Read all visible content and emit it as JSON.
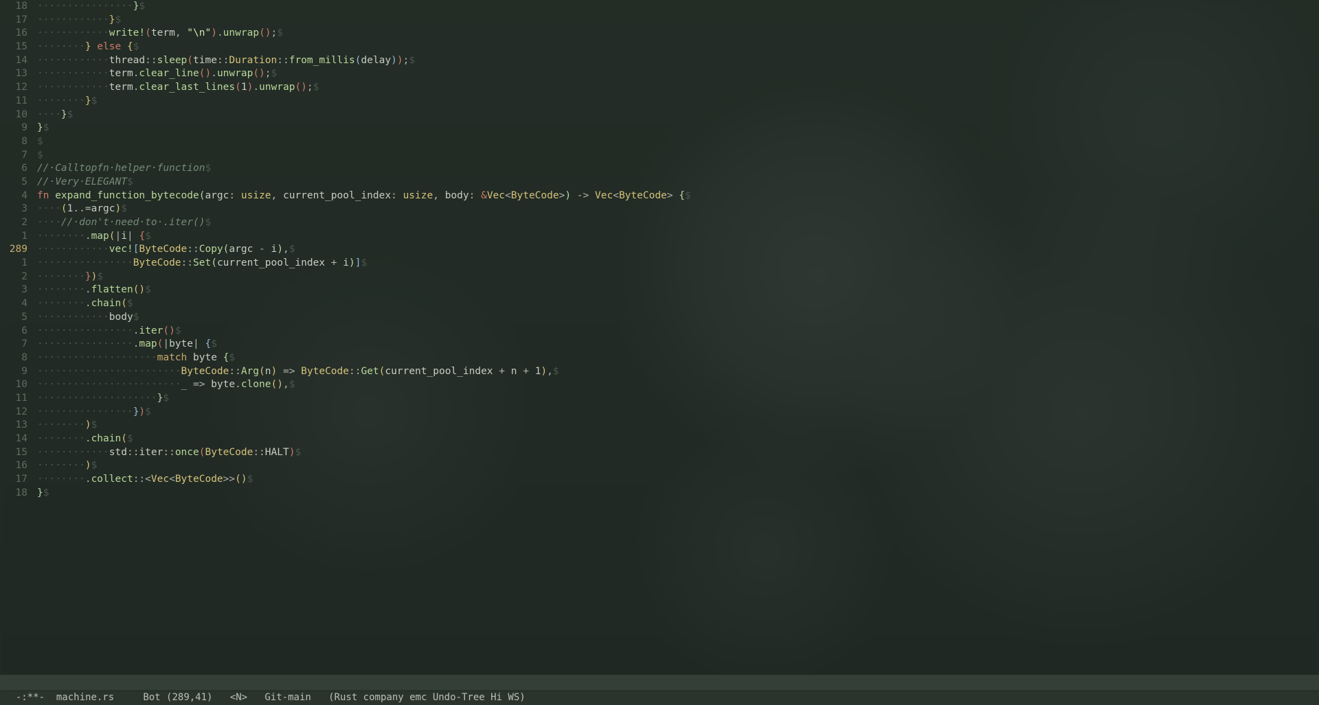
{
  "modeline": {
    "left": "-:**-",
    "buffer": "machine.rs",
    "position": "Bot (289,41)",
    "state": "<N>",
    "vc": "Git-main",
    "modes": "(Rust company emc Undo-Tree Hi WS)"
  },
  "cursor_line_index": 18,
  "lines": [
    {
      "num": "18",
      "tokens": [
        {
          "c": "ws",
          "t": "················"
        },
        {
          "c": "par1",
          "t": "}"
        },
        {
          "c": "eol",
          "t": "$"
        }
      ]
    },
    {
      "num": "17",
      "tokens": [
        {
          "c": "ws",
          "t": "············"
        },
        {
          "c": "par2",
          "t": "}"
        },
        {
          "c": "eol",
          "t": "$"
        }
      ]
    },
    {
      "num": "16",
      "tokens": [
        {
          "c": "ws",
          "t": "············"
        },
        {
          "c": "mac",
          "t": "write!"
        },
        {
          "c": "par3",
          "t": "("
        },
        {
          "c": "id",
          "t": "term"
        },
        {
          "c": "p",
          "t": ", "
        },
        {
          "c": "str",
          "t": "\"\\n\""
        },
        {
          "c": "par3",
          "t": ")"
        },
        {
          "c": "p",
          "t": "."
        },
        {
          "c": "fn",
          "t": "unwrap"
        },
        {
          "c": "par3",
          "t": "()"
        },
        {
          "c": "p",
          "t": ";"
        },
        {
          "c": "eol",
          "t": "$"
        }
      ]
    },
    {
      "num": "15",
      "tokens": [
        {
          "c": "ws",
          "t": "········"
        },
        {
          "c": "par2",
          "t": "}"
        },
        {
          "c": "p",
          "t": " "
        },
        {
          "c": "kw",
          "t": "else"
        },
        {
          "c": "p",
          "t": " "
        },
        {
          "c": "par2",
          "t": "{"
        },
        {
          "c": "eol",
          "t": "$"
        }
      ]
    },
    {
      "num": "14",
      "tokens": [
        {
          "c": "ws",
          "t": "············"
        },
        {
          "c": "id",
          "t": "thread"
        },
        {
          "c": "p",
          "t": "::"
        },
        {
          "c": "fn",
          "t": "sleep"
        },
        {
          "c": "par3",
          "t": "("
        },
        {
          "c": "id",
          "t": "time"
        },
        {
          "c": "p",
          "t": "::"
        },
        {
          "c": "ty",
          "t": "Duration"
        },
        {
          "c": "p",
          "t": "::"
        },
        {
          "c": "fn",
          "t": "from_millis"
        },
        {
          "c": "par4",
          "t": "("
        },
        {
          "c": "id",
          "t": "delay"
        },
        {
          "c": "par4",
          "t": ")"
        },
        {
          "c": "par3",
          "t": ")"
        },
        {
          "c": "p",
          "t": ";"
        },
        {
          "c": "eol",
          "t": "$"
        }
      ]
    },
    {
      "num": "13",
      "tokens": [
        {
          "c": "ws",
          "t": "············"
        },
        {
          "c": "id",
          "t": "term"
        },
        {
          "c": "p",
          "t": "."
        },
        {
          "c": "fn",
          "t": "clear_line"
        },
        {
          "c": "par3",
          "t": "()"
        },
        {
          "c": "p",
          "t": "."
        },
        {
          "c": "fn",
          "t": "unwrap"
        },
        {
          "c": "par3",
          "t": "()"
        },
        {
          "c": "p",
          "t": ";"
        },
        {
          "c": "eol",
          "t": "$"
        }
      ]
    },
    {
      "num": "12",
      "tokens": [
        {
          "c": "ws",
          "t": "············"
        },
        {
          "c": "id",
          "t": "term"
        },
        {
          "c": "p",
          "t": "."
        },
        {
          "c": "fn",
          "t": "clear_last_lines"
        },
        {
          "c": "par3",
          "t": "("
        },
        {
          "c": "num",
          "t": "1"
        },
        {
          "c": "par3",
          "t": ")"
        },
        {
          "c": "p",
          "t": "."
        },
        {
          "c": "fn",
          "t": "unwrap"
        },
        {
          "c": "par3",
          "t": "()"
        },
        {
          "c": "p",
          "t": ";"
        },
        {
          "c": "eol",
          "t": "$"
        }
      ]
    },
    {
      "num": "11",
      "tokens": [
        {
          "c": "ws",
          "t": "········"
        },
        {
          "c": "par2",
          "t": "}"
        },
        {
          "c": "eol",
          "t": "$"
        }
      ]
    },
    {
      "num": "10",
      "tokens": [
        {
          "c": "ws",
          "t": "····"
        },
        {
          "c": "par1",
          "t": "}"
        },
        {
          "c": "eol",
          "t": "$"
        }
      ]
    },
    {
      "num": "9",
      "tokens": [
        {
          "c": "par1",
          "t": "}"
        },
        {
          "c": "eol",
          "t": "$"
        }
      ]
    },
    {
      "num": "8",
      "tokens": [
        {
          "c": "eol",
          "t": "$"
        }
      ]
    },
    {
      "num": "7",
      "tokens": [
        {
          "c": "eol",
          "t": "$"
        }
      ]
    },
    {
      "num": "6",
      "tokens": [
        {
          "c": "cmt",
          "t": "// Calltopfn helper function"
        },
        {
          "c": "eol",
          "t": "$"
        }
      ]
    },
    {
      "num": "5",
      "tokens": [
        {
          "c": "cmt",
          "t": "// Very ELEGANT"
        },
        {
          "c": "eol",
          "t": "$"
        }
      ]
    },
    {
      "num": "4",
      "tokens": [
        {
          "c": "kw",
          "t": "fn"
        },
        {
          "c": "p",
          "t": " "
        },
        {
          "c": "fn",
          "t": "expand_function_bytecode"
        },
        {
          "c": "par1",
          "t": "("
        },
        {
          "c": "id",
          "t": "argc"
        },
        {
          "c": "p",
          "t": ": "
        },
        {
          "c": "ty",
          "t": "usize"
        },
        {
          "c": "p",
          "t": ", "
        },
        {
          "c": "id",
          "t": "current_pool_index"
        },
        {
          "c": "p",
          "t": ": "
        },
        {
          "c": "ty",
          "t": "usize"
        },
        {
          "c": "p",
          "t": ", "
        },
        {
          "c": "id",
          "t": "body"
        },
        {
          "c": "p",
          "t": ": "
        },
        {
          "c": "kw",
          "t": "&"
        },
        {
          "c": "ty",
          "t": "Vec"
        },
        {
          "c": "p",
          "t": "<"
        },
        {
          "c": "ty",
          "t": "ByteCode"
        },
        {
          "c": "p",
          "t": ">"
        },
        {
          "c": "par1",
          "t": ")"
        },
        {
          "c": "p",
          "t": " -> "
        },
        {
          "c": "ty",
          "t": "Vec"
        },
        {
          "c": "p",
          "t": "<"
        },
        {
          "c": "ty",
          "t": "ByteCode"
        },
        {
          "c": "p",
          "t": "> "
        },
        {
          "c": "par1",
          "t": "{"
        },
        {
          "c": "eol",
          "t": "$"
        }
      ]
    },
    {
      "num": "3",
      "tokens": [
        {
          "c": "ws",
          "t": "····"
        },
        {
          "c": "par2",
          "t": "("
        },
        {
          "c": "num",
          "t": "1"
        },
        {
          "c": "p",
          "t": "..="
        },
        {
          "c": "id",
          "t": "argc"
        },
        {
          "c": "par2",
          "t": ")"
        },
        {
          "c": "eol",
          "t": "$"
        }
      ]
    },
    {
      "num": "2",
      "tokens": [
        {
          "c": "ws",
          "t": "····"
        },
        {
          "c": "cmt",
          "t": "// don't need to .iter()"
        },
        {
          "c": "eol",
          "t": "$"
        }
      ]
    },
    {
      "num": "1",
      "tokens": [
        {
          "c": "ws",
          "t": "········"
        },
        {
          "c": "p",
          "t": "."
        },
        {
          "c": "fn",
          "t": "map"
        },
        {
          "c": "par2",
          "t": "("
        },
        {
          "c": "p",
          "t": "|"
        },
        {
          "c": "id",
          "t": "i"
        },
        {
          "c": "p",
          "t": "| "
        },
        {
          "c": "par3",
          "t": "{"
        },
        {
          "c": "eol",
          "t": "$"
        }
      ]
    },
    {
      "num": "289",
      "cur": true,
      "tokens": [
        {
          "c": "ws",
          "t": "············"
        },
        {
          "c": "mac",
          "t": "vec!"
        },
        {
          "c": "par4",
          "t": "["
        },
        {
          "c": "ty",
          "t": "ByteCode"
        },
        {
          "c": "p",
          "t": "::"
        },
        {
          "c": "fn",
          "t": "Copy"
        },
        {
          "c": "par1",
          "t": "("
        },
        {
          "c": "id",
          "t": "argc"
        },
        {
          "c": "p",
          "t": " - "
        },
        {
          "c": "id",
          "t": "i"
        },
        {
          "c": "par1",
          "t": ")"
        },
        {
          "c": "p",
          "t": ","
        },
        {
          "c": "eol",
          "t": "$"
        }
      ]
    },
    {
      "num": "1",
      "tokens": [
        {
          "c": "ws",
          "t": "················"
        },
        {
          "c": "ty",
          "t": "ByteCode"
        },
        {
          "c": "p",
          "t": "::"
        },
        {
          "c": "fn",
          "t": "Set"
        },
        {
          "c": "par1",
          "t": "("
        },
        {
          "c": "id",
          "t": "current_pool_index"
        },
        {
          "c": "p",
          "t": " + "
        },
        {
          "c": "id",
          "t": "i"
        },
        {
          "c": "par1",
          "t": ")"
        },
        {
          "c": "par4",
          "t": "]"
        },
        {
          "c": "eol",
          "t": "$"
        }
      ]
    },
    {
      "num": "2",
      "tokens": [
        {
          "c": "ws",
          "t": "········"
        },
        {
          "c": "par3",
          "t": "}"
        },
        {
          "c": "par2",
          "t": ")"
        },
        {
          "c": "eol",
          "t": "$"
        }
      ]
    },
    {
      "num": "3",
      "tokens": [
        {
          "c": "ws",
          "t": "········"
        },
        {
          "c": "p",
          "t": "."
        },
        {
          "c": "fn",
          "t": "flatten"
        },
        {
          "c": "par2",
          "t": "()"
        },
        {
          "c": "eol",
          "t": "$"
        }
      ]
    },
    {
      "num": "4",
      "tokens": [
        {
          "c": "ws",
          "t": "········"
        },
        {
          "c": "p",
          "t": "."
        },
        {
          "c": "fn",
          "t": "chain"
        },
        {
          "c": "par2",
          "t": "("
        },
        {
          "c": "eol",
          "t": "$"
        }
      ]
    },
    {
      "num": "5",
      "tokens": [
        {
          "c": "ws",
          "t": "············"
        },
        {
          "c": "id",
          "t": "body"
        },
        {
          "c": "eol",
          "t": "$"
        }
      ]
    },
    {
      "num": "6",
      "tokens": [
        {
          "c": "ws",
          "t": "················"
        },
        {
          "c": "p",
          "t": "."
        },
        {
          "c": "fn",
          "t": "iter"
        },
        {
          "c": "par3",
          "t": "()"
        },
        {
          "c": "eol",
          "t": "$"
        }
      ]
    },
    {
      "num": "7",
      "tokens": [
        {
          "c": "ws",
          "t": "················"
        },
        {
          "c": "p",
          "t": "."
        },
        {
          "c": "fn",
          "t": "map"
        },
        {
          "c": "par3",
          "t": "("
        },
        {
          "c": "p",
          "t": "|"
        },
        {
          "c": "id",
          "t": "byte"
        },
        {
          "c": "p",
          "t": "| "
        },
        {
          "c": "par4",
          "t": "{"
        },
        {
          "c": "eol",
          "t": "$"
        }
      ]
    },
    {
      "num": "8",
      "tokens": [
        {
          "c": "ws",
          "t": "····················"
        },
        {
          "c": "kw2",
          "t": "match"
        },
        {
          "c": "p",
          "t": " "
        },
        {
          "c": "id",
          "t": "byte"
        },
        {
          "c": "p",
          "t": " "
        },
        {
          "c": "par1",
          "t": "{"
        },
        {
          "c": "eol",
          "t": "$"
        }
      ]
    },
    {
      "num": "9",
      "tokens": [
        {
          "c": "ws",
          "t": "························"
        },
        {
          "c": "ty",
          "t": "ByteCode"
        },
        {
          "c": "p",
          "t": "::"
        },
        {
          "c": "fn",
          "t": "Arg"
        },
        {
          "c": "par2",
          "t": "("
        },
        {
          "c": "id",
          "t": "n"
        },
        {
          "c": "par2",
          "t": ")"
        },
        {
          "c": "p",
          "t": " => "
        },
        {
          "c": "ty",
          "t": "ByteCode"
        },
        {
          "c": "p",
          "t": "::"
        },
        {
          "c": "fn",
          "t": "Get"
        },
        {
          "c": "par2",
          "t": "("
        },
        {
          "c": "id",
          "t": "current_pool_index"
        },
        {
          "c": "p",
          "t": " + "
        },
        {
          "c": "id",
          "t": "n"
        },
        {
          "c": "p",
          "t": " + "
        },
        {
          "c": "num",
          "t": "1"
        },
        {
          "c": "par2",
          "t": ")"
        },
        {
          "c": "p",
          "t": ","
        },
        {
          "c": "eol",
          "t": "$"
        }
      ]
    },
    {
      "num": "10",
      "tokens": [
        {
          "c": "ws",
          "t": "························"
        },
        {
          "c": "p",
          "t": "_ => "
        },
        {
          "c": "id",
          "t": "byte"
        },
        {
          "c": "p",
          "t": "."
        },
        {
          "c": "fn",
          "t": "clone"
        },
        {
          "c": "par2",
          "t": "()"
        },
        {
          "c": "p",
          "t": ","
        },
        {
          "c": "eol",
          "t": "$"
        }
      ]
    },
    {
      "num": "11",
      "tokens": [
        {
          "c": "ws",
          "t": "····················"
        },
        {
          "c": "par1",
          "t": "}"
        },
        {
          "c": "eol",
          "t": "$"
        }
      ]
    },
    {
      "num": "12",
      "tokens": [
        {
          "c": "ws",
          "t": "················"
        },
        {
          "c": "par4",
          "t": "}"
        },
        {
          "c": "par3",
          "t": ")"
        },
        {
          "c": "eol",
          "t": "$"
        }
      ]
    },
    {
      "num": "13",
      "tokens": [
        {
          "c": "ws",
          "t": "········"
        },
        {
          "c": "par2",
          "t": ")"
        },
        {
          "c": "eol",
          "t": "$"
        }
      ]
    },
    {
      "num": "14",
      "tokens": [
        {
          "c": "ws",
          "t": "········"
        },
        {
          "c": "p",
          "t": "."
        },
        {
          "c": "fn",
          "t": "chain"
        },
        {
          "c": "par2",
          "t": "("
        },
        {
          "c": "eol",
          "t": "$"
        }
      ]
    },
    {
      "num": "15",
      "tokens": [
        {
          "c": "ws",
          "t": "············"
        },
        {
          "c": "id",
          "t": "std"
        },
        {
          "c": "p",
          "t": "::"
        },
        {
          "c": "id",
          "t": "iter"
        },
        {
          "c": "p",
          "t": "::"
        },
        {
          "c": "fn",
          "t": "once"
        },
        {
          "c": "par3",
          "t": "("
        },
        {
          "c": "ty",
          "t": "ByteCode"
        },
        {
          "c": "p",
          "t": "::"
        },
        {
          "c": "id",
          "t": "HALT"
        },
        {
          "c": "par3",
          "t": ")"
        },
        {
          "c": "eol",
          "t": "$"
        }
      ]
    },
    {
      "num": "16",
      "tokens": [
        {
          "c": "ws",
          "t": "········"
        },
        {
          "c": "par2",
          "t": ")"
        },
        {
          "c": "eol",
          "t": "$"
        }
      ]
    },
    {
      "num": "17",
      "tokens": [
        {
          "c": "ws",
          "t": "········"
        },
        {
          "c": "p",
          "t": "."
        },
        {
          "c": "fn",
          "t": "collect"
        },
        {
          "c": "p",
          "t": "::<"
        },
        {
          "c": "ty",
          "t": "Vec"
        },
        {
          "c": "p",
          "t": "<"
        },
        {
          "c": "ty",
          "t": "ByteCode"
        },
        {
          "c": "p",
          "t": ">>"
        },
        {
          "c": "par2",
          "t": "()"
        },
        {
          "c": "eol",
          "t": "$"
        }
      ]
    },
    {
      "num": "18",
      "tokens": [
        {
          "c": "par1",
          "t": "}"
        },
        {
          "c": "eol",
          "t": "$"
        }
      ]
    }
  ]
}
